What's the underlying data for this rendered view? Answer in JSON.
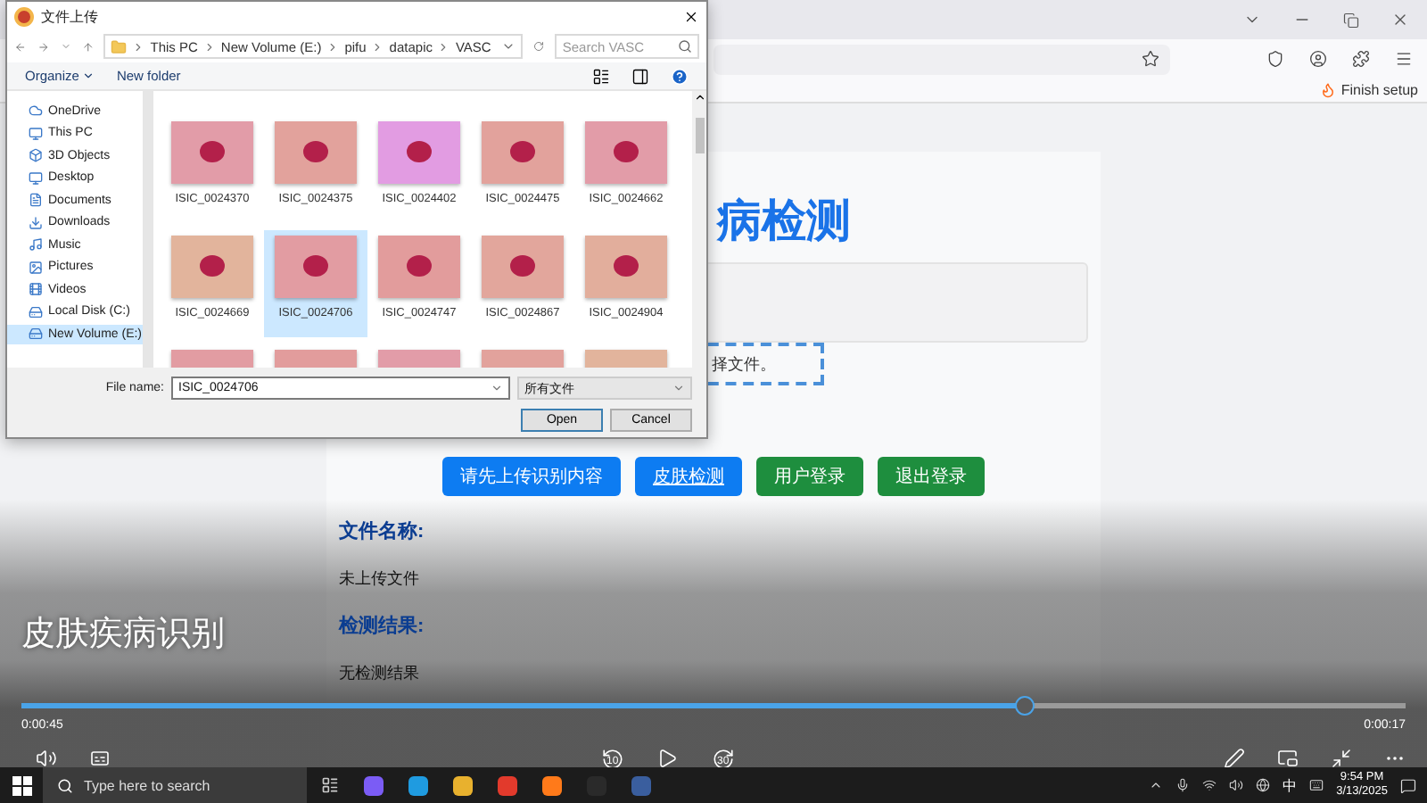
{
  "browser": {
    "bookmark": "Finish setup"
  },
  "page": {
    "heading": "病检测",
    "upload_hint": "择文件。",
    "buttons": [
      {
        "label": "请先上传识别内容",
        "kind": "primary"
      },
      {
        "label": "皮肤检测",
        "kind": "link"
      },
      {
        "label": "用户登录",
        "kind": "success"
      },
      {
        "label": "退出登录",
        "kind": "success"
      }
    ],
    "sections": [
      {
        "label": "文件名称:",
        "value": "未上传文件"
      },
      {
        "label": "检测结果:",
        "value": "无检测结果"
      }
    ]
  },
  "dialog": {
    "title": "文件上传",
    "breadcrumb": [
      "This PC",
      "New Volume (E:)",
      "pifu",
      "datapic",
      "VASC"
    ],
    "search": {
      "placeholder": "Search VASC"
    },
    "toolbar": [
      "Organize",
      "New folder"
    ],
    "sidebar": [
      {
        "label": "OneDrive",
        "selected": false
      },
      {
        "label": "This PC",
        "selected": false
      },
      {
        "label": "3D Objects",
        "selected": false
      },
      {
        "label": "Desktop",
        "selected": false
      },
      {
        "label": "Documents",
        "selected": false
      },
      {
        "label": "Downloads",
        "selected": false
      },
      {
        "label": "Music",
        "selected": false
      },
      {
        "label": "Pictures",
        "selected": false
      },
      {
        "label": "Videos",
        "selected": false
      },
      {
        "label": "Local Disk (C:)",
        "selected": false
      },
      {
        "label": "New Volume (E:)",
        "selected": true
      }
    ],
    "files": [
      {
        "name": "ISIC_0024370",
        "selected": false
      },
      {
        "name": "ISIC_0024375",
        "selected": false
      },
      {
        "name": "ISIC_0024402",
        "selected": false
      },
      {
        "name": "ISIC_0024475",
        "selected": false
      },
      {
        "name": "ISIC_0024662",
        "selected": false
      },
      {
        "name": "ISIC_0024669",
        "selected": false
      },
      {
        "name": "ISIC_0024706",
        "selected": true
      },
      {
        "name": "ISIC_0024747",
        "selected": false
      },
      {
        "name": "ISIC_0024867",
        "selected": false
      },
      {
        "name": "ISIC_0024904",
        "selected": false
      },
      {
        "selected": false
      },
      {
        "selected": false
      },
      {
        "selected": false
      },
      {
        "selected": false
      },
      {
        "selected": false
      }
    ],
    "file_name_label": "File name:",
    "file_name": {
      "value": "ISIC_0024706"
    },
    "filter": "所有文件",
    "buttons": [
      {
        "label": "Open",
        "kind": "default"
      },
      {
        "label": "Cancel",
        "kind": "normal"
      }
    ]
  },
  "player": {
    "title": "皮肤疾病识别",
    "progress": {
      "level": 0.724
    },
    "elapsed": "0:00:45",
    "remaining": "0:00:17",
    "skip_back": "10",
    "skip_forward": "30"
  },
  "taskbar": {
    "search": {
      "placeholder": "Type here to search"
    },
    "ime": "中",
    "time": "9:54 PM",
    "date": "3/13/2025"
  }
}
